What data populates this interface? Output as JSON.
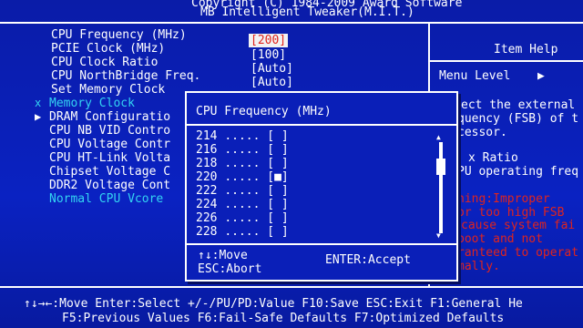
{
  "header": {
    "copyright": "Copyright (C) 1984-2009 Award Software",
    "title": "MB Intelligent Tweaker(M.I.T.)"
  },
  "settings": [
    {
      "label": "CPU Frequency (MHz)",
      "value": "[200]"
    },
    {
      "label": "PCIE Clock (MHz)",
      "value": "[100]"
    },
    {
      "label": "CPU Clock Ratio",
      "value": "[Auto]"
    },
    {
      "label": "CPU NorthBridge Freq.",
      "value": "[Auto]"
    },
    {
      "label": "Set Memory Clock",
      "value": ""
    },
    {
      "label": "Memory Clock",
      "value": "",
      "marker": "x"
    },
    {
      "label": "DRAM Configuratio",
      "value": "",
      "marker": "▶"
    },
    {
      "label": "CPU NB VID Contro",
      "value": ""
    },
    {
      "label": "CPU Voltage Contr",
      "value": ""
    },
    {
      "label": "CPU HT-Link Volta",
      "value": ""
    },
    {
      "label": "Chipset Voltage C",
      "value": ""
    },
    {
      "label": "DDR2 Voltage Cont",
      "value": ""
    },
    {
      "label": "Normal CPU Vcore",
      "value": ""
    }
  ],
  "help": {
    "title": "Item Help",
    "menu_level": "Menu Level",
    "menu_arrow": "▶",
    "lines": [
      "ect the external",
      "quency (FSB) of t",
      "cessor.",
      "x Ratio",
      "PU operating freq"
    ],
    "warning_lines": [
      "ning:Improper",
      " or too high FSB",
      "cause system fai",
      "boot and not",
      "ranteed to operat",
      "mally."
    ]
  },
  "popup": {
    "title": "CPU Frequency (MHz)",
    "options": [
      {
        "value": "214",
        "dots": ".....",
        "box": "[ ]"
      },
      {
        "value": "216",
        "dots": ".....",
        "box": "[ ]"
      },
      {
        "value": "218",
        "dots": ".....",
        "box": "[ ]"
      },
      {
        "value": "220",
        "dots": ".....",
        "box": "[■]"
      },
      {
        "value": "222",
        "dots": ".....",
        "box": "[ ]"
      },
      {
        "value": "224",
        "dots": ".....",
        "box": "[ ]"
      },
      {
        "value": "226",
        "dots": ".....",
        "box": "[ ]"
      },
      {
        "value": "228",
        "dots": ".....",
        "box": "[ ]"
      }
    ],
    "move_hint": "↑↓:Move",
    "abort_hint": "ESC:Abort",
    "accept_hint": "ENTER:Accept",
    "scroll_up": "▲",
    "scroll_down": "▼"
  },
  "footer": {
    "line1": "↑↓→←:Move  Enter:Select  +/-/PU/PD:Value  F10:Save  ESC:Exit  F1:General He",
    "line2": "F5:Previous Values  F6:Fail-Safe Defaults  F7:Optimized Defaults"
  },
  "colors": {
    "background": "#0a1fb8",
    "cyan_text": "#33d4f2",
    "red_text": "#e0241d",
    "selected_bg": "#f2f2f2"
  }
}
